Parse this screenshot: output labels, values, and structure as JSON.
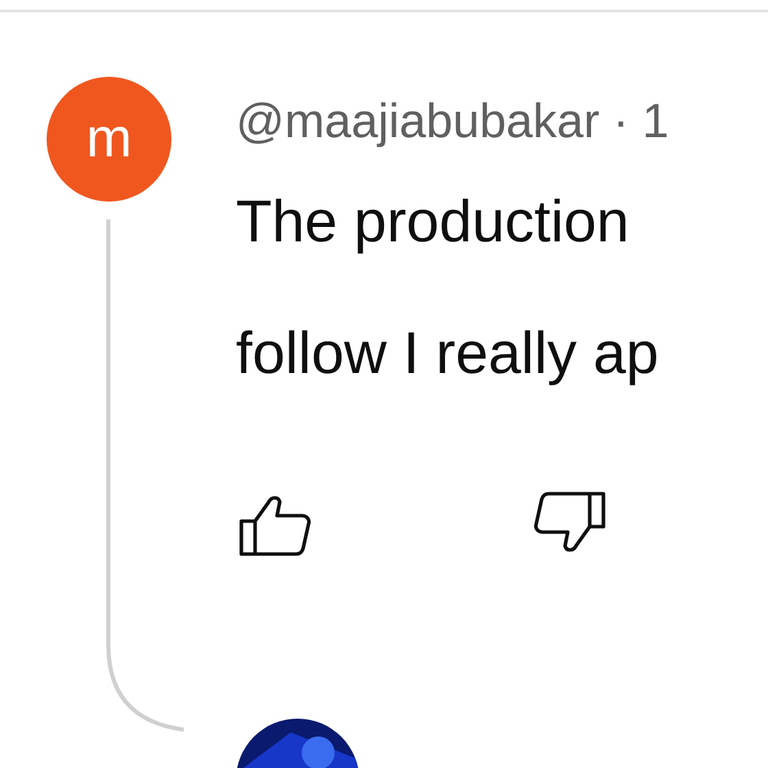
{
  "comment": {
    "avatar_letter": "m",
    "byline": "@maajiabubakar · 1",
    "text_lines": [
      "The production",
      "follow I really ap"
    ]
  }
}
